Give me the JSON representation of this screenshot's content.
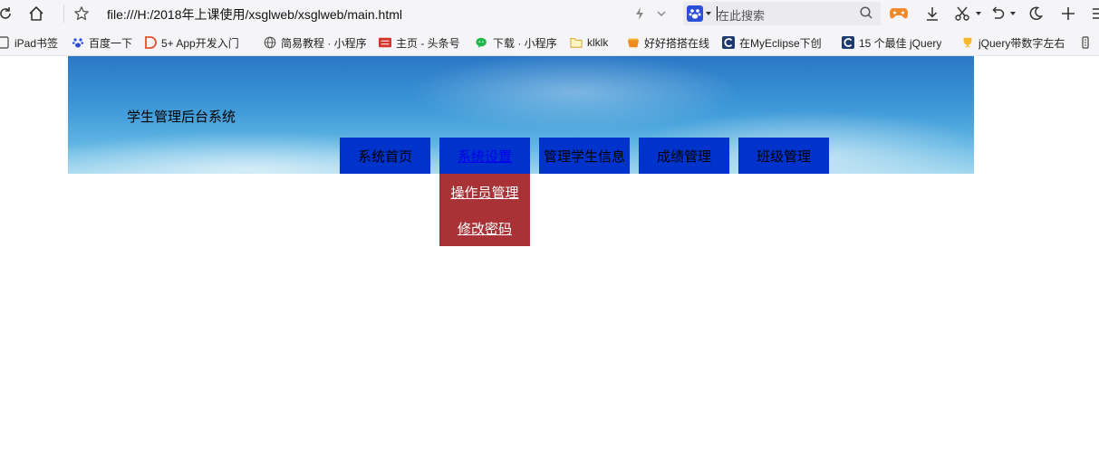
{
  "browser": {
    "url": "file:///H:/2018年上课使用/xsglweb/xsglweb/main.html",
    "search_placeholder": "在此搜索",
    "bookmarks": [
      {
        "label": "iPad书签"
      },
      {
        "label": "百度一下"
      },
      {
        "label": "5+ App开发入门"
      },
      {
        "label": "简易教程 · 小程序"
      },
      {
        "label": "主页 - 头条号"
      },
      {
        "label": "下载 · 小程序"
      },
      {
        "label": "klklk"
      },
      {
        "label": "好好搭搭在线"
      },
      {
        "label": "在MyEclipse下创"
      },
      {
        "label": "15 个最佳 jQuery"
      },
      {
        "label": "jQuery带数字左右"
      }
    ],
    "colors": {
      "chrome_bg": "#f5f5f7",
      "search_bg": "#ebebef"
    }
  },
  "page": {
    "site_title": "学生管理后台系统",
    "nav": [
      {
        "label": "系统首页"
      },
      {
        "label": "系统设置"
      },
      {
        "label": "管理学生信息"
      },
      {
        "label": "成绩管理"
      },
      {
        "label": "班级管理"
      }
    ],
    "submenu": [
      {
        "label": "操作员管理"
      },
      {
        "label": "修改密码"
      }
    ],
    "colors": {
      "nav_bg": "#0033cc",
      "submenu_bg": "#a83236",
      "banner_sky": "#3a95d6"
    }
  }
}
